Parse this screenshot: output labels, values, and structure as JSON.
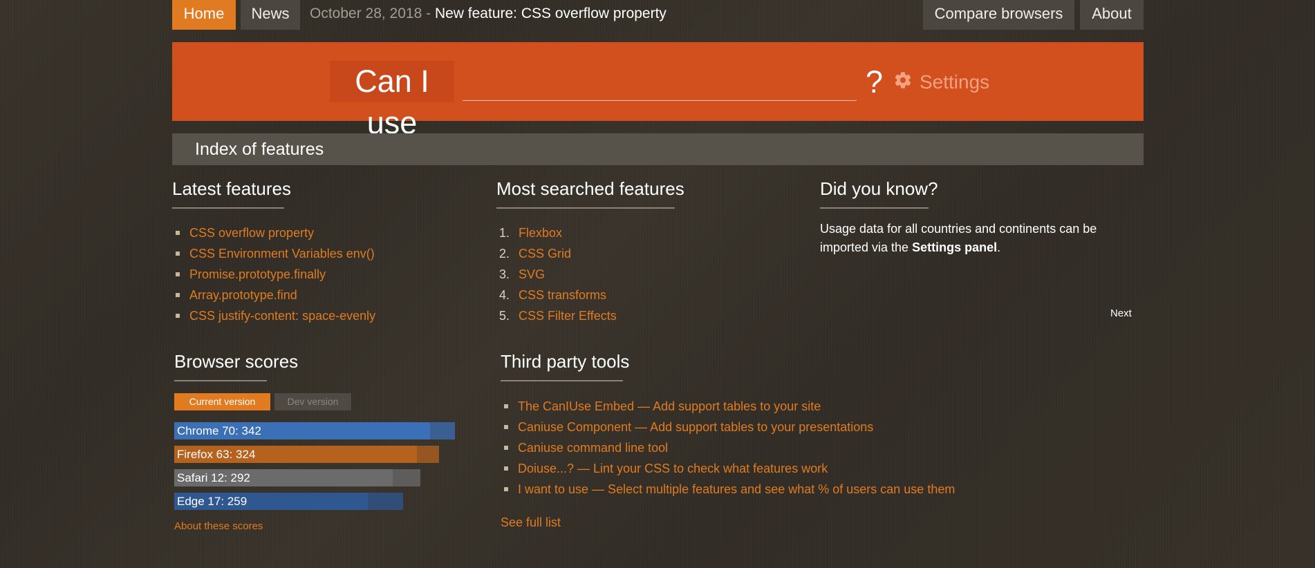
{
  "nav": {
    "home": "Home",
    "news": "News",
    "compare": "Compare browsers",
    "about": "About"
  },
  "news_line": {
    "date": "October 28, 2018",
    "separator": " - ",
    "headline": "New feature: CSS overflow property"
  },
  "search": {
    "prefix": "Can I use",
    "value": "",
    "suffix": "?",
    "settings_label": "Settings"
  },
  "index_bar": {
    "label": "Index of features"
  },
  "latest": {
    "title": "Latest features",
    "items": [
      "CSS overflow property",
      "CSS Environment Variables env()",
      "Promise.prototype.finally",
      "Array.prototype.find",
      "CSS justify-content: space-evenly"
    ]
  },
  "most_searched": {
    "title": "Most searched features",
    "items": [
      {
        "num": "1.",
        "label": "Flexbox"
      },
      {
        "num": "2.",
        "label": "CSS Grid"
      },
      {
        "num": "3.",
        "label": "SVG"
      },
      {
        "num": "4.",
        "label": "CSS transforms"
      },
      {
        "num": "5.",
        "label": "CSS Filter Effects"
      }
    ]
  },
  "did_you_know": {
    "title": "Did you know?",
    "text_before": "Usage data for all countries and continents can be imported via the ",
    "bold": "Settings panel",
    "text_after": ".",
    "next": "Next"
  },
  "browser_scores": {
    "title": "Browser scores",
    "tab_current": "Current version",
    "tab_dev": "Dev version",
    "scores": [
      {
        "label": "Chrome 70: 342",
        "value": 342,
        "max": 375,
        "color": "#3b6fb6"
      },
      {
        "label": "Firefox 63: 324",
        "value": 324,
        "max": 354,
        "color": "#b5621f"
      },
      {
        "label": "Safari 12: 292",
        "value": 292,
        "max": 329,
        "color": "#6b6b6b"
      },
      {
        "label": "Edge 17: 259",
        "value": 259,
        "max": 306,
        "color": "#2f5792"
      }
    ],
    "about_link": "About these scores"
  },
  "third_party": {
    "title": "Third party tools",
    "items": [
      "The CanIUse Embed — Add support tables to your site",
      "Caniuse Component — Add support tables to your presentations",
      "Caniuse command line tool",
      "Doiuse...? — Lint your CSS to check what features work",
      "I want to use — Select multiple features and see what % of users can use them"
    ],
    "see_full": "See full list"
  },
  "colors": {
    "accent": "#e07b22",
    "banner": "#d24f1e",
    "background": "#37322b"
  }
}
